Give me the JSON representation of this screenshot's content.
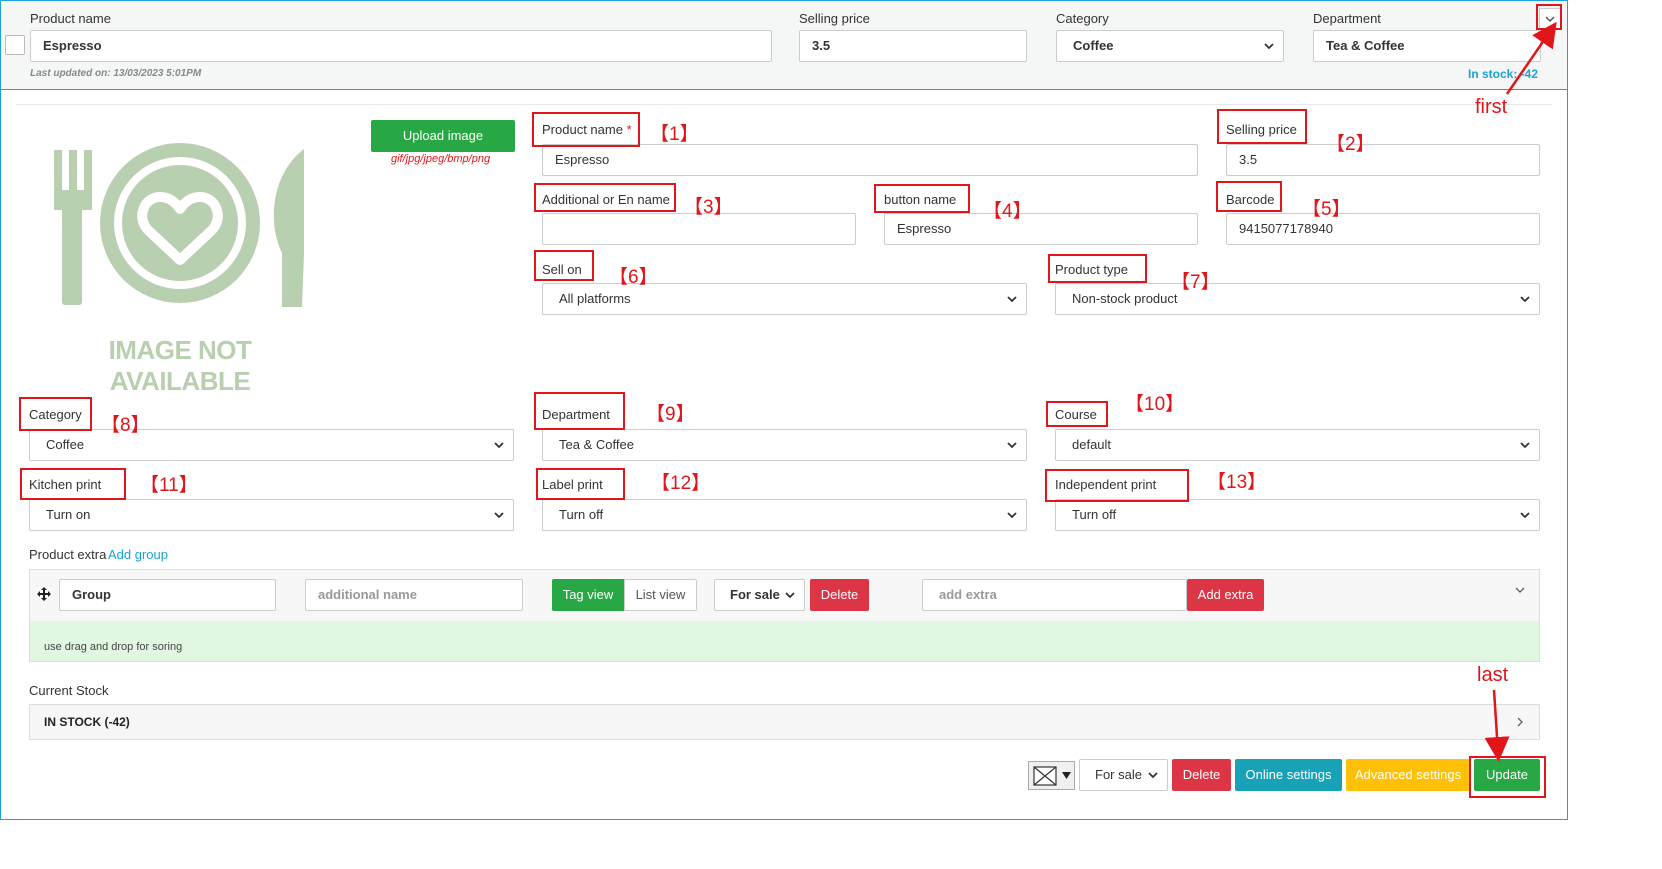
{
  "header": {
    "product_name_label": "Product name",
    "product_name_value": "Espresso",
    "selling_price_label": "Selling price",
    "selling_price_value": "3.5",
    "category_label": "Category",
    "category_value": "Coffee",
    "department_label": "Department",
    "department_value": "Tea & Coffee",
    "last_updated": "Last updated on: 13/03/2023 5:01PM",
    "in_stock": "In stock: -42"
  },
  "image": {
    "placeholder_text": "IMAGE NOT AVAILABLE",
    "upload_label": "Upload image",
    "formats": "gif/jpg/jpeg/bmp/png"
  },
  "form": {
    "product_name_label": "Product name",
    "required_mark": "*",
    "product_name_value": "Espresso",
    "selling_price_label": "Selling price",
    "selling_price_value": "3.5",
    "additional_name_label": "Additional or En name",
    "additional_name_value": "",
    "button_name_label": "button name",
    "button_name_value": "Espresso",
    "barcode_label": "Barcode",
    "barcode_value": "9415077178940",
    "sell_on_label": "Sell on",
    "sell_on_value": "All platforms",
    "product_type_label": "Product type",
    "product_type_value": "Non-stock product",
    "category_label": "Category",
    "category_value": "Coffee",
    "department_label": "Department",
    "department_value": "Tea & Coffee",
    "course_label": "Course",
    "course_value": "default",
    "kitchen_print_label": "Kitchen print",
    "kitchen_print_value": "Turn on",
    "label_print_label": "Label print",
    "label_print_value": "Turn off",
    "independent_print_label": "Independent print",
    "independent_print_value": "Turn off"
  },
  "extras": {
    "title": "Product extra",
    "add_group": "Add group",
    "group_value": "Group",
    "additional_name_placeholder": "additional name",
    "tag_view": "Tag view",
    "list_view": "List view",
    "for_sale": "For sale",
    "delete": "Delete",
    "add_extra_placeholder": "add extra",
    "add_extra": "Add extra",
    "hint": "use drag and drop for soring"
  },
  "stock": {
    "title": "Current Stock",
    "status": "IN STOCK (-42)"
  },
  "footer": {
    "sale_select": "For sale",
    "delete": "Delete",
    "online_settings": "Online settings",
    "advanced_settings": "Advanced settings",
    "update": "Update"
  },
  "annotations": {
    "n1": "【1】",
    "n2": "【2】",
    "n3": "【3】",
    "n4": "【4】",
    "n5": "【5】",
    "n6": "【6】",
    "n7": "【7】",
    "n8": "【8】",
    "n9": "【9】",
    "n10": "【10】",
    "n11": "【11】",
    "n12": "【12】",
    "n13": "【13】",
    "first": "first",
    "last": "last"
  },
  "colors": {
    "accent_blue": "#1aa3d6",
    "green": "#28a745",
    "red": "#dc3545",
    "cyan": "#17a2b8",
    "yellow": "#ffc107",
    "annotation_red": "#e0161b"
  }
}
